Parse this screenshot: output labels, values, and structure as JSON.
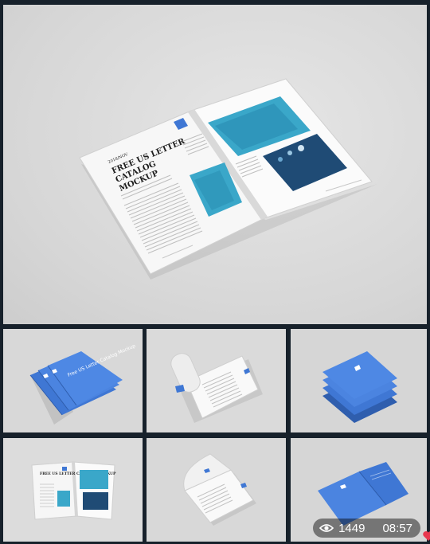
{
  "hero": {
    "date": "2018/NOV",
    "headline": [
      "FREE US LETTER",
      "CATALOG",
      "MOCKUP"
    ],
    "lede": "Lorem ipsum dolor sit amet consectetur adipisicing elit",
    "accent_color": "#3f77d4",
    "photo_color": "#3aa7c9"
  },
  "thumbs": [
    {
      "label": "catalog-stack-blue-cover",
      "cover_text": "Free US Letter Catalog Mockup"
    },
    {
      "label": "catalog-rolled-open"
    },
    {
      "label": "catalog-stack-three"
    },
    {
      "label": "catalog-spread-open",
      "headline": "FREE US LETTER CATALOG MOCKUP"
    },
    {
      "label": "catalog-page-curl"
    },
    {
      "label": "catalog-back-cover"
    }
  ],
  "stats": {
    "views": "1449",
    "time": "08:57"
  }
}
